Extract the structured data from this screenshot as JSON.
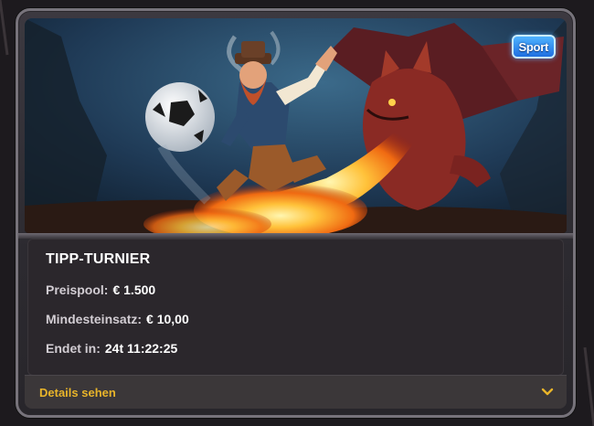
{
  "hero": {
    "badge_label": "Sport",
    "icon": "football-dwarf-dragon-artwork"
  },
  "tournament": {
    "title": "TIPP-TURNIER",
    "prize_pool_label": "Preispool:",
    "prize_pool_value": "€ 1.500",
    "min_stake_label": "Mindesteinsatz:",
    "min_stake_value": "€ 10,00",
    "ends_label": "Endet in:",
    "ends_value": "24t 11:22:25"
  },
  "details": {
    "label": "Details sehen",
    "icon": "chevron-down-icon"
  },
  "colors": {
    "background": "#1d1a1e",
    "card": "#2b272c",
    "accent": "#e8b42a",
    "badge": "#1f6fe0"
  }
}
